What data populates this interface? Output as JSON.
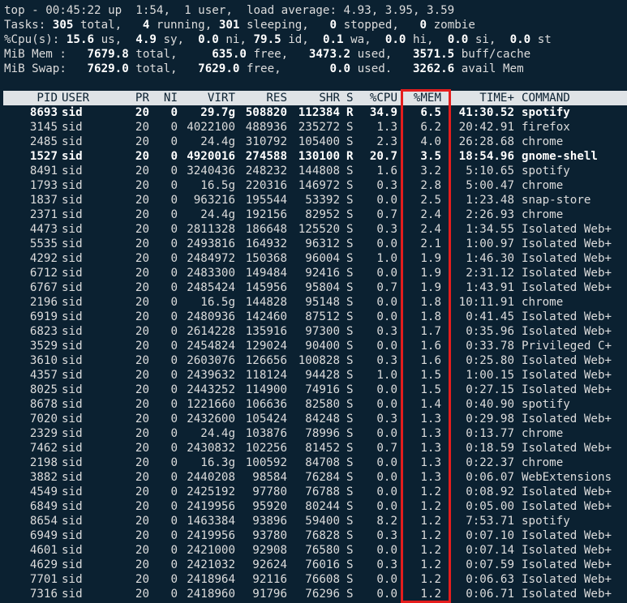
{
  "summary": {
    "line1": "top - 00:45:22 up  1:54,  1 user,  load average: 4.93, 3.95, 3.59",
    "tasks": {
      "label": "Tasks: ",
      "total": "305",
      "total_lbl": " total,   ",
      "running": "4",
      "running_lbl": " running, ",
      "sleeping": "301",
      "sleeping_lbl": " sleeping,   ",
      "stopped": "0",
      "stopped_lbl": " stopped,   ",
      "zombie": "0",
      "zombie_lbl": " zombie"
    },
    "cpu": {
      "label": "%Cpu(s): ",
      "us": "15.6",
      "us_lbl": " us,  ",
      "sy": "4.9",
      "sy_lbl": " sy,  ",
      "ni": "0.0",
      "ni_lbl": " ni, ",
      "id": "79.5",
      "id_lbl": " id,  ",
      "wa": "0.1",
      "wa_lbl": " wa,  ",
      "hi": "0.0",
      "hi_lbl": " hi,  ",
      "si": "0.0",
      "si_lbl": " si,  ",
      "st": "0.0",
      "st_lbl": " st"
    },
    "mem": {
      "label": "MiB Mem :   ",
      "total": "7679.8",
      "total_lbl": " total,     ",
      "free": "635.0",
      "free_lbl": " free,   ",
      "used": "3473.2",
      "used_lbl": " used,   ",
      "cache": "3571.5",
      "cache_lbl": " buff/cache"
    },
    "swap": {
      "label": "MiB Swap:   ",
      "total": "7629.0",
      "total_lbl": " total,   ",
      "free": "7629.0",
      "free_lbl": " free,       ",
      "used": "0.0",
      "used_lbl": " used.   ",
      "avail": "3262.6",
      "avail_lbl": " avail Mem"
    }
  },
  "columns": [
    "PID",
    "USER",
    "PR",
    "NI",
    "VIRT",
    "RES",
    "SHR",
    "S",
    "%CPU",
    "%MEM",
    "TIME+",
    "COMMAND"
  ],
  "highlight_color": "#e51d1d",
  "header_bg": "#dfe3e6",
  "terminal_bg": "#0b2131",
  "processes": [
    {
      "pid": "8693",
      "user": "sid",
      "pr": "20",
      "ni": "0",
      "virt": "29.7g",
      "res": "508820",
      "shr": "112384",
      "s": "R",
      "cpu": "34.9",
      "mem": "6.5",
      "time": "41:30.52",
      "cmd": "spotify",
      "bold": true
    },
    {
      "pid": "3145",
      "user": "sid",
      "pr": "20",
      "ni": "0",
      "virt": "4022100",
      "res": "488936",
      "shr": "235272",
      "s": "S",
      "cpu": "1.3",
      "mem": "6.2",
      "time": "20:42.91",
      "cmd": "firefox"
    },
    {
      "pid": "2485",
      "user": "sid",
      "pr": "20",
      "ni": "0",
      "virt": "24.4g",
      "res": "310792",
      "shr": "105400",
      "s": "S",
      "cpu": "2.3",
      "mem": "4.0",
      "time": "26:28.68",
      "cmd": "chrome"
    },
    {
      "pid": "1527",
      "user": "sid",
      "pr": "20",
      "ni": "0",
      "virt": "4920016",
      "res": "274588",
      "shr": "130100",
      "s": "R",
      "cpu": "20.7",
      "mem": "3.5",
      "time": "18:54.96",
      "cmd": "gnome-shell",
      "bold": true
    },
    {
      "pid": "8491",
      "user": "sid",
      "pr": "20",
      "ni": "0",
      "virt": "3240436",
      "res": "248232",
      "shr": "144808",
      "s": "S",
      "cpu": "1.6",
      "mem": "3.2",
      "time": "5:10.65",
      "cmd": "spotify"
    },
    {
      "pid": "1793",
      "user": "sid",
      "pr": "20",
      "ni": "0",
      "virt": "16.5g",
      "res": "220316",
      "shr": "146972",
      "s": "S",
      "cpu": "0.3",
      "mem": "2.8",
      "time": "5:00.47",
      "cmd": "chrome"
    },
    {
      "pid": "1837",
      "user": "sid",
      "pr": "20",
      "ni": "0",
      "virt": "963216",
      "res": "195544",
      "shr": "53392",
      "s": "S",
      "cpu": "0.0",
      "mem": "2.5",
      "time": "1:23.48",
      "cmd": "snap-store"
    },
    {
      "pid": "2371",
      "user": "sid",
      "pr": "20",
      "ni": "0",
      "virt": "24.4g",
      "res": "192156",
      "shr": "82952",
      "s": "S",
      "cpu": "0.7",
      "mem": "2.4",
      "time": "2:26.93",
      "cmd": "chrome"
    },
    {
      "pid": "4473",
      "user": "sid",
      "pr": "20",
      "ni": "0",
      "virt": "2811328",
      "res": "186648",
      "shr": "125520",
      "s": "S",
      "cpu": "0.3",
      "mem": "2.4",
      "time": "1:34.55",
      "cmd": "Isolated Web+"
    },
    {
      "pid": "5535",
      "user": "sid",
      "pr": "20",
      "ni": "0",
      "virt": "2493816",
      "res": "164932",
      "shr": "96312",
      "s": "S",
      "cpu": "0.0",
      "mem": "2.1",
      "time": "1:00.97",
      "cmd": "Isolated Web+"
    },
    {
      "pid": "4292",
      "user": "sid",
      "pr": "20",
      "ni": "0",
      "virt": "2484972",
      "res": "150368",
      "shr": "96004",
      "s": "S",
      "cpu": "1.0",
      "mem": "1.9",
      "time": "1:46.30",
      "cmd": "Isolated Web+"
    },
    {
      "pid": "6712",
      "user": "sid",
      "pr": "20",
      "ni": "0",
      "virt": "2483300",
      "res": "149484",
      "shr": "92416",
      "s": "S",
      "cpu": "0.0",
      "mem": "1.9",
      "time": "2:31.12",
      "cmd": "Isolated Web+"
    },
    {
      "pid": "6767",
      "user": "sid",
      "pr": "20",
      "ni": "0",
      "virt": "2485424",
      "res": "145956",
      "shr": "95804",
      "s": "S",
      "cpu": "0.7",
      "mem": "1.9",
      "time": "1:43.91",
      "cmd": "Isolated Web+"
    },
    {
      "pid": "2196",
      "user": "sid",
      "pr": "20",
      "ni": "0",
      "virt": "16.5g",
      "res": "144828",
      "shr": "95148",
      "s": "S",
      "cpu": "0.0",
      "mem": "1.8",
      "time": "10:11.91",
      "cmd": "chrome"
    },
    {
      "pid": "6919",
      "user": "sid",
      "pr": "20",
      "ni": "0",
      "virt": "2480936",
      "res": "142460",
      "shr": "87512",
      "s": "S",
      "cpu": "0.0",
      "mem": "1.8",
      "time": "0:41.45",
      "cmd": "Isolated Web+"
    },
    {
      "pid": "6823",
      "user": "sid",
      "pr": "20",
      "ni": "0",
      "virt": "2614228",
      "res": "135916",
      "shr": "97300",
      "s": "S",
      "cpu": "0.3",
      "mem": "1.7",
      "time": "0:35.96",
      "cmd": "Isolated Web+"
    },
    {
      "pid": "3529",
      "user": "sid",
      "pr": "20",
      "ni": "0",
      "virt": "2454824",
      "res": "129024",
      "shr": "90400",
      "s": "S",
      "cpu": "0.0",
      "mem": "1.6",
      "time": "0:33.78",
      "cmd": "Privileged C+"
    },
    {
      "pid": "3610",
      "user": "sid",
      "pr": "20",
      "ni": "0",
      "virt": "2603076",
      "res": "126656",
      "shr": "100828",
      "s": "S",
      "cpu": "0.3",
      "mem": "1.6",
      "time": "0:25.80",
      "cmd": "Isolated Web+"
    },
    {
      "pid": "4357",
      "user": "sid",
      "pr": "20",
      "ni": "0",
      "virt": "2439632",
      "res": "118124",
      "shr": "94428",
      "s": "S",
      "cpu": "1.0",
      "mem": "1.5",
      "time": "1:00.15",
      "cmd": "Isolated Web+"
    },
    {
      "pid": "8025",
      "user": "sid",
      "pr": "20",
      "ni": "0",
      "virt": "2443252",
      "res": "114900",
      "shr": "74916",
      "s": "S",
      "cpu": "0.0",
      "mem": "1.5",
      "time": "0:27.15",
      "cmd": "Isolated Web+"
    },
    {
      "pid": "8678",
      "user": "sid",
      "pr": "20",
      "ni": "0",
      "virt": "1221660",
      "res": "106636",
      "shr": "82580",
      "s": "S",
      "cpu": "0.0",
      "mem": "1.4",
      "time": "0:40.90",
      "cmd": "spotify"
    },
    {
      "pid": "7020",
      "user": "sid",
      "pr": "20",
      "ni": "0",
      "virt": "2432600",
      "res": "105424",
      "shr": "84248",
      "s": "S",
      "cpu": "0.3",
      "mem": "1.3",
      "time": "0:29.98",
      "cmd": "Isolated Web+"
    },
    {
      "pid": "2329",
      "user": "sid",
      "pr": "20",
      "ni": "0",
      "virt": "24.4g",
      "res": "103876",
      "shr": "78996",
      "s": "S",
      "cpu": "0.0",
      "mem": "1.3",
      "time": "0:13.77",
      "cmd": "chrome"
    },
    {
      "pid": "7462",
      "user": "sid",
      "pr": "20",
      "ni": "0",
      "virt": "2430832",
      "res": "102256",
      "shr": "81452",
      "s": "S",
      "cpu": "0.7",
      "mem": "1.3",
      "time": "0:18.59",
      "cmd": "Isolated Web+"
    },
    {
      "pid": "2198",
      "user": "sid",
      "pr": "20",
      "ni": "0",
      "virt": "16.3g",
      "res": "100592",
      "shr": "84708",
      "s": "S",
      "cpu": "0.0",
      "mem": "1.3",
      "time": "0:22.37",
      "cmd": "chrome"
    },
    {
      "pid": "3882",
      "user": "sid",
      "pr": "20",
      "ni": "0",
      "virt": "2440208",
      "res": "98584",
      "shr": "76284",
      "s": "S",
      "cpu": "0.0",
      "mem": "1.3",
      "time": "0:06.07",
      "cmd": "WebExtensions"
    },
    {
      "pid": "4549",
      "user": "sid",
      "pr": "20",
      "ni": "0",
      "virt": "2425192",
      "res": "97780",
      "shr": "76788",
      "s": "S",
      "cpu": "0.0",
      "mem": "1.2",
      "time": "0:08.92",
      "cmd": "Isolated Web+"
    },
    {
      "pid": "6849",
      "user": "sid",
      "pr": "20",
      "ni": "0",
      "virt": "2419956",
      "res": "95920",
      "shr": "80244",
      "s": "S",
      "cpu": "0.0",
      "mem": "1.2",
      "time": "0:05.00",
      "cmd": "Isolated Web+"
    },
    {
      "pid": "8654",
      "user": "sid",
      "pr": "20",
      "ni": "0",
      "virt": "1463384",
      "res": "93896",
      "shr": "59400",
      "s": "S",
      "cpu": "8.2",
      "mem": "1.2",
      "time": "7:53.71",
      "cmd": "spotify"
    },
    {
      "pid": "6949",
      "user": "sid",
      "pr": "20",
      "ni": "0",
      "virt": "2419956",
      "res": "93780",
      "shr": "76828",
      "s": "S",
      "cpu": "0.3",
      "mem": "1.2",
      "time": "0:07.10",
      "cmd": "Isolated Web+"
    },
    {
      "pid": "4601",
      "user": "sid",
      "pr": "20",
      "ni": "0",
      "virt": "2421000",
      "res": "92908",
      "shr": "76580",
      "s": "S",
      "cpu": "0.0",
      "mem": "1.2",
      "time": "0:07.14",
      "cmd": "Isolated Web+"
    },
    {
      "pid": "4629",
      "user": "sid",
      "pr": "20",
      "ni": "0",
      "virt": "2421032",
      "res": "92624",
      "shr": "76016",
      "s": "S",
      "cpu": "0.3",
      "mem": "1.2",
      "time": "0:07.59",
      "cmd": "Isolated Web+"
    },
    {
      "pid": "7701",
      "user": "sid",
      "pr": "20",
      "ni": "0",
      "virt": "2418964",
      "res": "92116",
      "shr": "76608",
      "s": "S",
      "cpu": "0.0",
      "mem": "1.2",
      "time": "0:06.63",
      "cmd": "Isolated Web+"
    },
    {
      "pid": "7316",
      "user": "sid",
      "pr": "20",
      "ni": "0",
      "virt": "2418960",
      "res": "91796",
      "shr": "76296",
      "s": "S",
      "cpu": "0.0",
      "mem": "1.2",
      "time": "0:06.71",
      "cmd": "Isolated Web+"
    }
  ]
}
